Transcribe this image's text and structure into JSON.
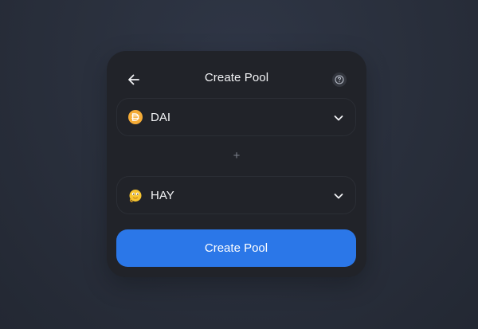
{
  "header": {
    "title": "Create Pool",
    "back_icon": "arrow-left-icon",
    "help_icon": "question-circle-icon"
  },
  "token_a": {
    "symbol": "DAI",
    "icon": "dai-token-icon",
    "color": "#f5ac37",
    "chevron_icon": "chevron-down-icon"
  },
  "separator": "+",
  "token_b": {
    "symbol": "HAY",
    "icon": "hay-token-icon",
    "color": "#f7c531",
    "chevron_icon": "chevron-down-icon"
  },
  "action": {
    "label": "Create Pool",
    "color": "#2b77e8"
  }
}
